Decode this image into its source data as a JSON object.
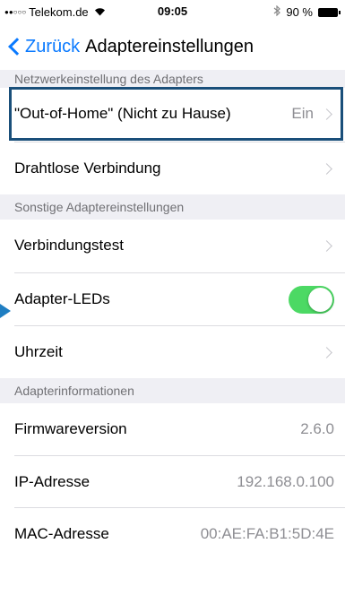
{
  "status_bar": {
    "signal_dots": "●●○○○",
    "carrier": "Telekom.de",
    "wifi_icon": "wifi-icon",
    "time": "09:05",
    "bluetooth_icon": "bluetooth-icon",
    "battery": "90 %"
  },
  "nav": {
    "back_label": "Zurück",
    "title": "Adaptereinstellungen"
  },
  "sections": {
    "network_header": "Netzwerkeinstellung des Adapters",
    "other_header": "Sonstige Adaptereinstellungen",
    "info_header": "Adapterinformationen"
  },
  "rows": {
    "out_of_home": {
      "label": "\"Out-of-Home\" (Nicht zu Hause)",
      "value": "Ein"
    },
    "wireless": {
      "label": "Drahtlose Verbindung"
    },
    "connection_test": {
      "label": "Verbindungstest"
    },
    "adapter_leds": {
      "label": "Adapter-LEDs",
      "toggle_on": true
    },
    "time": {
      "label": "Uhrzeit"
    },
    "firmware": {
      "label": "Firmwareversion",
      "value": "2.6.0"
    },
    "ip": {
      "label": "IP-Adresse",
      "value": "192.168.0.100"
    },
    "mac": {
      "label": "MAC-Adresse",
      "value": "00:AE:FA:B1:5D:4E"
    }
  },
  "colors": {
    "accent": "#0a7aff",
    "toggle_on": "#4cd964",
    "highlight_border": "#1a4f7a",
    "section_bg": "#efeff4"
  }
}
